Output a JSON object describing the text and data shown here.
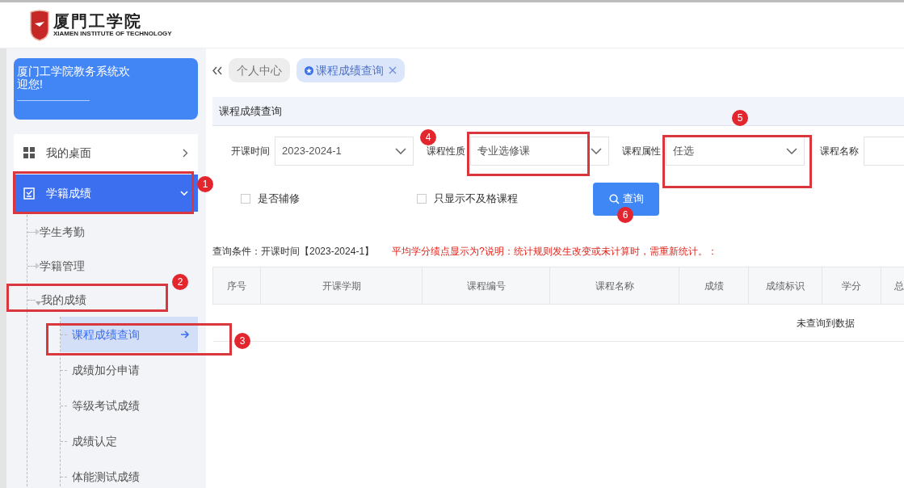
{
  "logo": {
    "name": "厦門工学院",
    "subtitle": "XIAMEN INSTITUTE OF TECHNOLOGY"
  },
  "sidebar": {
    "welcome": "厦门工学院教务系统欢迎您!",
    "items": [
      {
        "label": "我的桌面",
        "selected": false,
        "expanded": false
      },
      {
        "label": "学籍成绩",
        "selected": true,
        "expanded": true,
        "children": [
          {
            "label": "学生考勤",
            "expanded": false
          },
          {
            "label": "学籍管理",
            "expanded": false
          },
          {
            "label": "我的成绩",
            "expanded": true,
            "children": [
              {
                "label": "课程成绩查询",
                "selected": true
              },
              {
                "label": "成绩加分申请",
                "selected": false
              },
              {
                "label": "等级考试成绩",
                "selected": false
              },
              {
                "label": "成绩认定",
                "selected": false
              },
              {
                "label": "体能测试成绩",
                "selected": false
              }
            ]
          }
        ]
      }
    ]
  },
  "tabs": [
    {
      "label": "个人中心",
      "selected": false,
      "closable": false
    },
    {
      "label": "课程成绩查询",
      "selected": true,
      "closable": true
    }
  ],
  "panel_title": "课程成绩查询",
  "filters": [
    {
      "kind": "select",
      "label": "开课时间",
      "value": "2023-2024-1"
    },
    {
      "kind": "select",
      "label": "课程性质",
      "value": "专业选修课"
    },
    {
      "kind": "select",
      "label": "课程属性",
      "value": "任选"
    },
    {
      "kind": "text",
      "label": "课程名称"
    }
  ],
  "checkboxes": [
    {
      "label": "是否辅修",
      "checked": false
    },
    {
      "label": "只显示不及格课程",
      "checked": false
    }
  ],
  "query_button": "查询",
  "conditions": "查询条件：开课时间【2023-2024-1】",
  "notice": "平均学分绩点显示为?说明：统计规则发生改变或未计算时，需重新统计。：",
  "table": {
    "columns": [
      "序号",
      "开课学期",
      "课程编号",
      "课程名称",
      "成绩",
      "成绩标识",
      "学分",
      "总"
    ],
    "empty_message": "未查询到数据"
  },
  "annotations": [
    {
      "number": "1"
    },
    {
      "number": "2"
    },
    {
      "number": "3"
    },
    {
      "number": "4"
    },
    {
      "number": "5"
    },
    {
      "number": "6"
    }
  ]
}
